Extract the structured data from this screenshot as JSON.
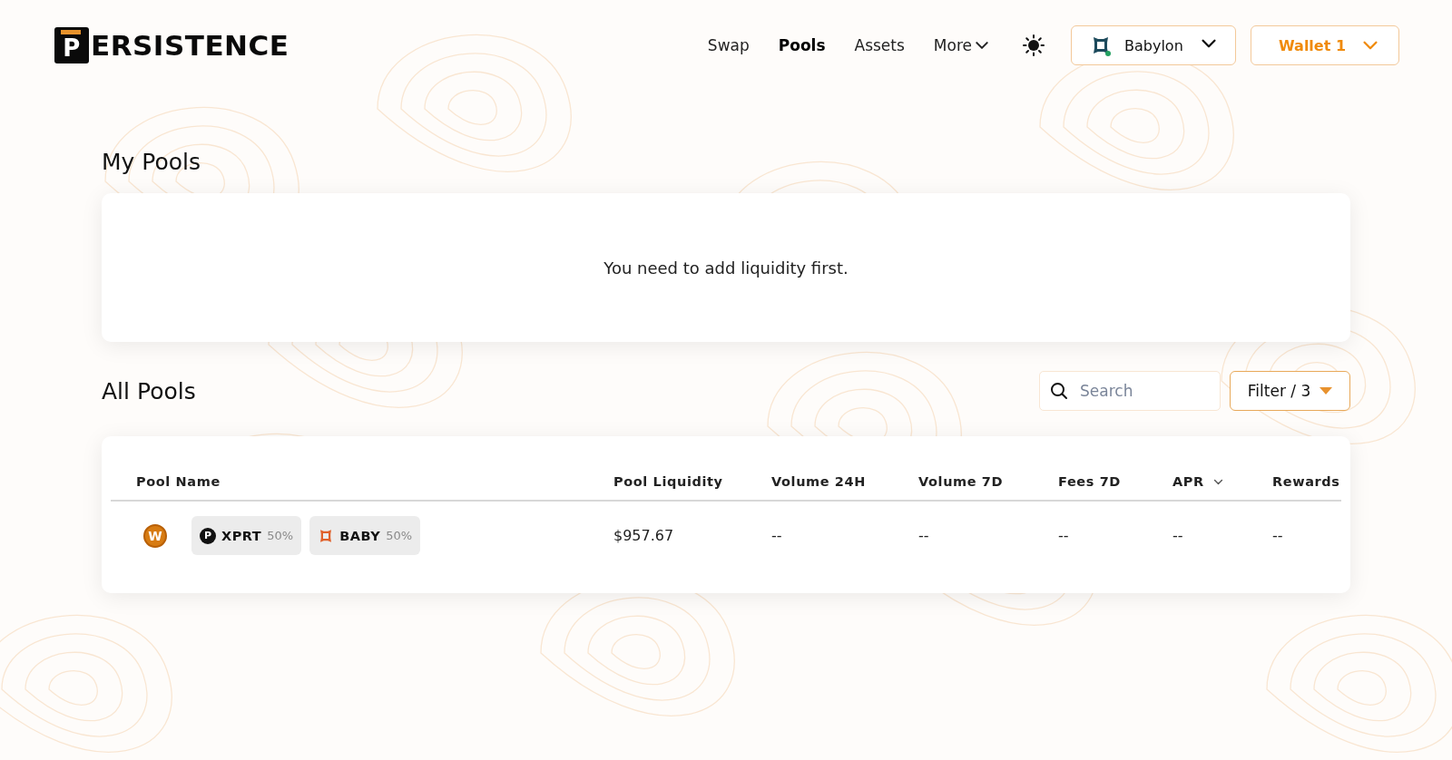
{
  "logo": {
    "mark": "P",
    "text": "ERSISTENCE"
  },
  "nav": [
    {
      "label": "Swap",
      "selected": false,
      "kind": "link"
    },
    {
      "label": "Pools",
      "selected": true,
      "kind": "link"
    },
    {
      "label": "Assets",
      "selected": false,
      "kind": "link"
    },
    {
      "label": "More",
      "selected": false,
      "kind": "menu"
    }
  ],
  "network": {
    "label": "Babylon"
  },
  "wallet": {
    "label": "Wallet 1"
  },
  "my_pools": {
    "title": "My Pools",
    "empty_message": "You need to add liquidity first."
  },
  "all_pools": {
    "title": "All Pools",
    "search": {
      "placeholder": "Search"
    },
    "filter": {
      "label": "Filter / 3"
    },
    "table": {
      "columns": [
        {
          "label": "Pool Name",
          "sortable": false
        },
        {
          "label": "Pool Liquidity",
          "sortable": false
        },
        {
          "label": "Volume 24H",
          "sortable": false
        },
        {
          "label": "Volume 7D",
          "sortable": false
        },
        {
          "label": "Fees 7D",
          "sortable": false
        },
        {
          "label": "APR",
          "sortable": true
        },
        {
          "label": "Rewards",
          "sortable": false
        }
      ],
      "rows": [
        {
          "pool_badge": "W",
          "tokens": [
            {
              "kind": "xprt",
              "badge": "P",
              "symbol": "XPRT",
              "weight": "50%"
            },
            {
              "kind": "baby",
              "symbol": "BABY",
              "weight": "50%"
            }
          ],
          "liquidity": "$957.67",
          "volume_24h": "--",
          "volume_7d": "--",
          "fees_7d": "--",
          "apr": "--",
          "rewards": "--"
        }
      ]
    }
  }
}
